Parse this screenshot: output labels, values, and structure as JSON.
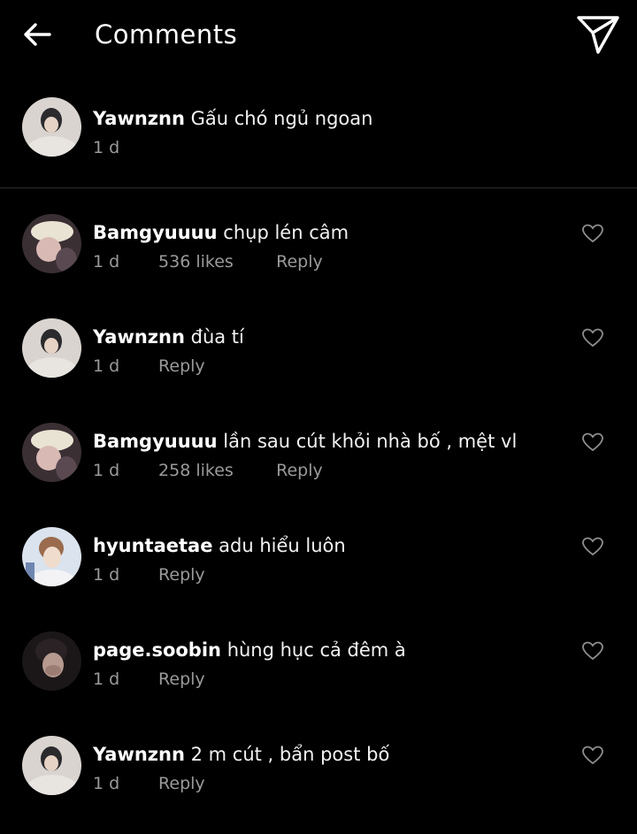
{
  "header": {
    "title": "Comments"
  },
  "caption": {
    "username": "Yawnznn",
    "text": "Gấu chó ngủ ngoan",
    "time": "1 d"
  },
  "comments": [
    {
      "username": "Bamgyuuuu",
      "text": "chụp lén câm",
      "time": "1 d",
      "likes": "536 likes",
      "reply": "Reply"
    },
    {
      "username": "Yawnznn",
      "text": "đùa tí",
      "time": "1 d",
      "likes": "",
      "reply": "Reply"
    },
    {
      "username": "Bamgyuuuu",
      "text": "lần sau cút khỏi nhà bố , mệt vl",
      "time": "1 d",
      "likes": "258 likes",
      "reply": "Reply"
    },
    {
      "username": "hyuntaetae",
      "text": "adu hiểu luôn",
      "time": "1 d",
      "likes": "",
      "reply": "Reply"
    },
    {
      "username": "page.soobin",
      "text": "hùng hục cả đêm à",
      "time": "1 d",
      "likes": "",
      "reply": "Reply"
    },
    {
      "username": "Yawnznn",
      "text": "2 m cút , bẩn post bố",
      "time": "1 d",
      "likes": "",
      "reply": "Reply"
    }
  ],
  "icons": {
    "back": "arrow-left-icon",
    "send": "paper-plane-icon",
    "like": "heart-outline-icon"
  },
  "colors": {
    "background": "#000000",
    "text": "#ffffff",
    "secondary": "#9a9a9a",
    "divider": "#2a2a2a"
  }
}
